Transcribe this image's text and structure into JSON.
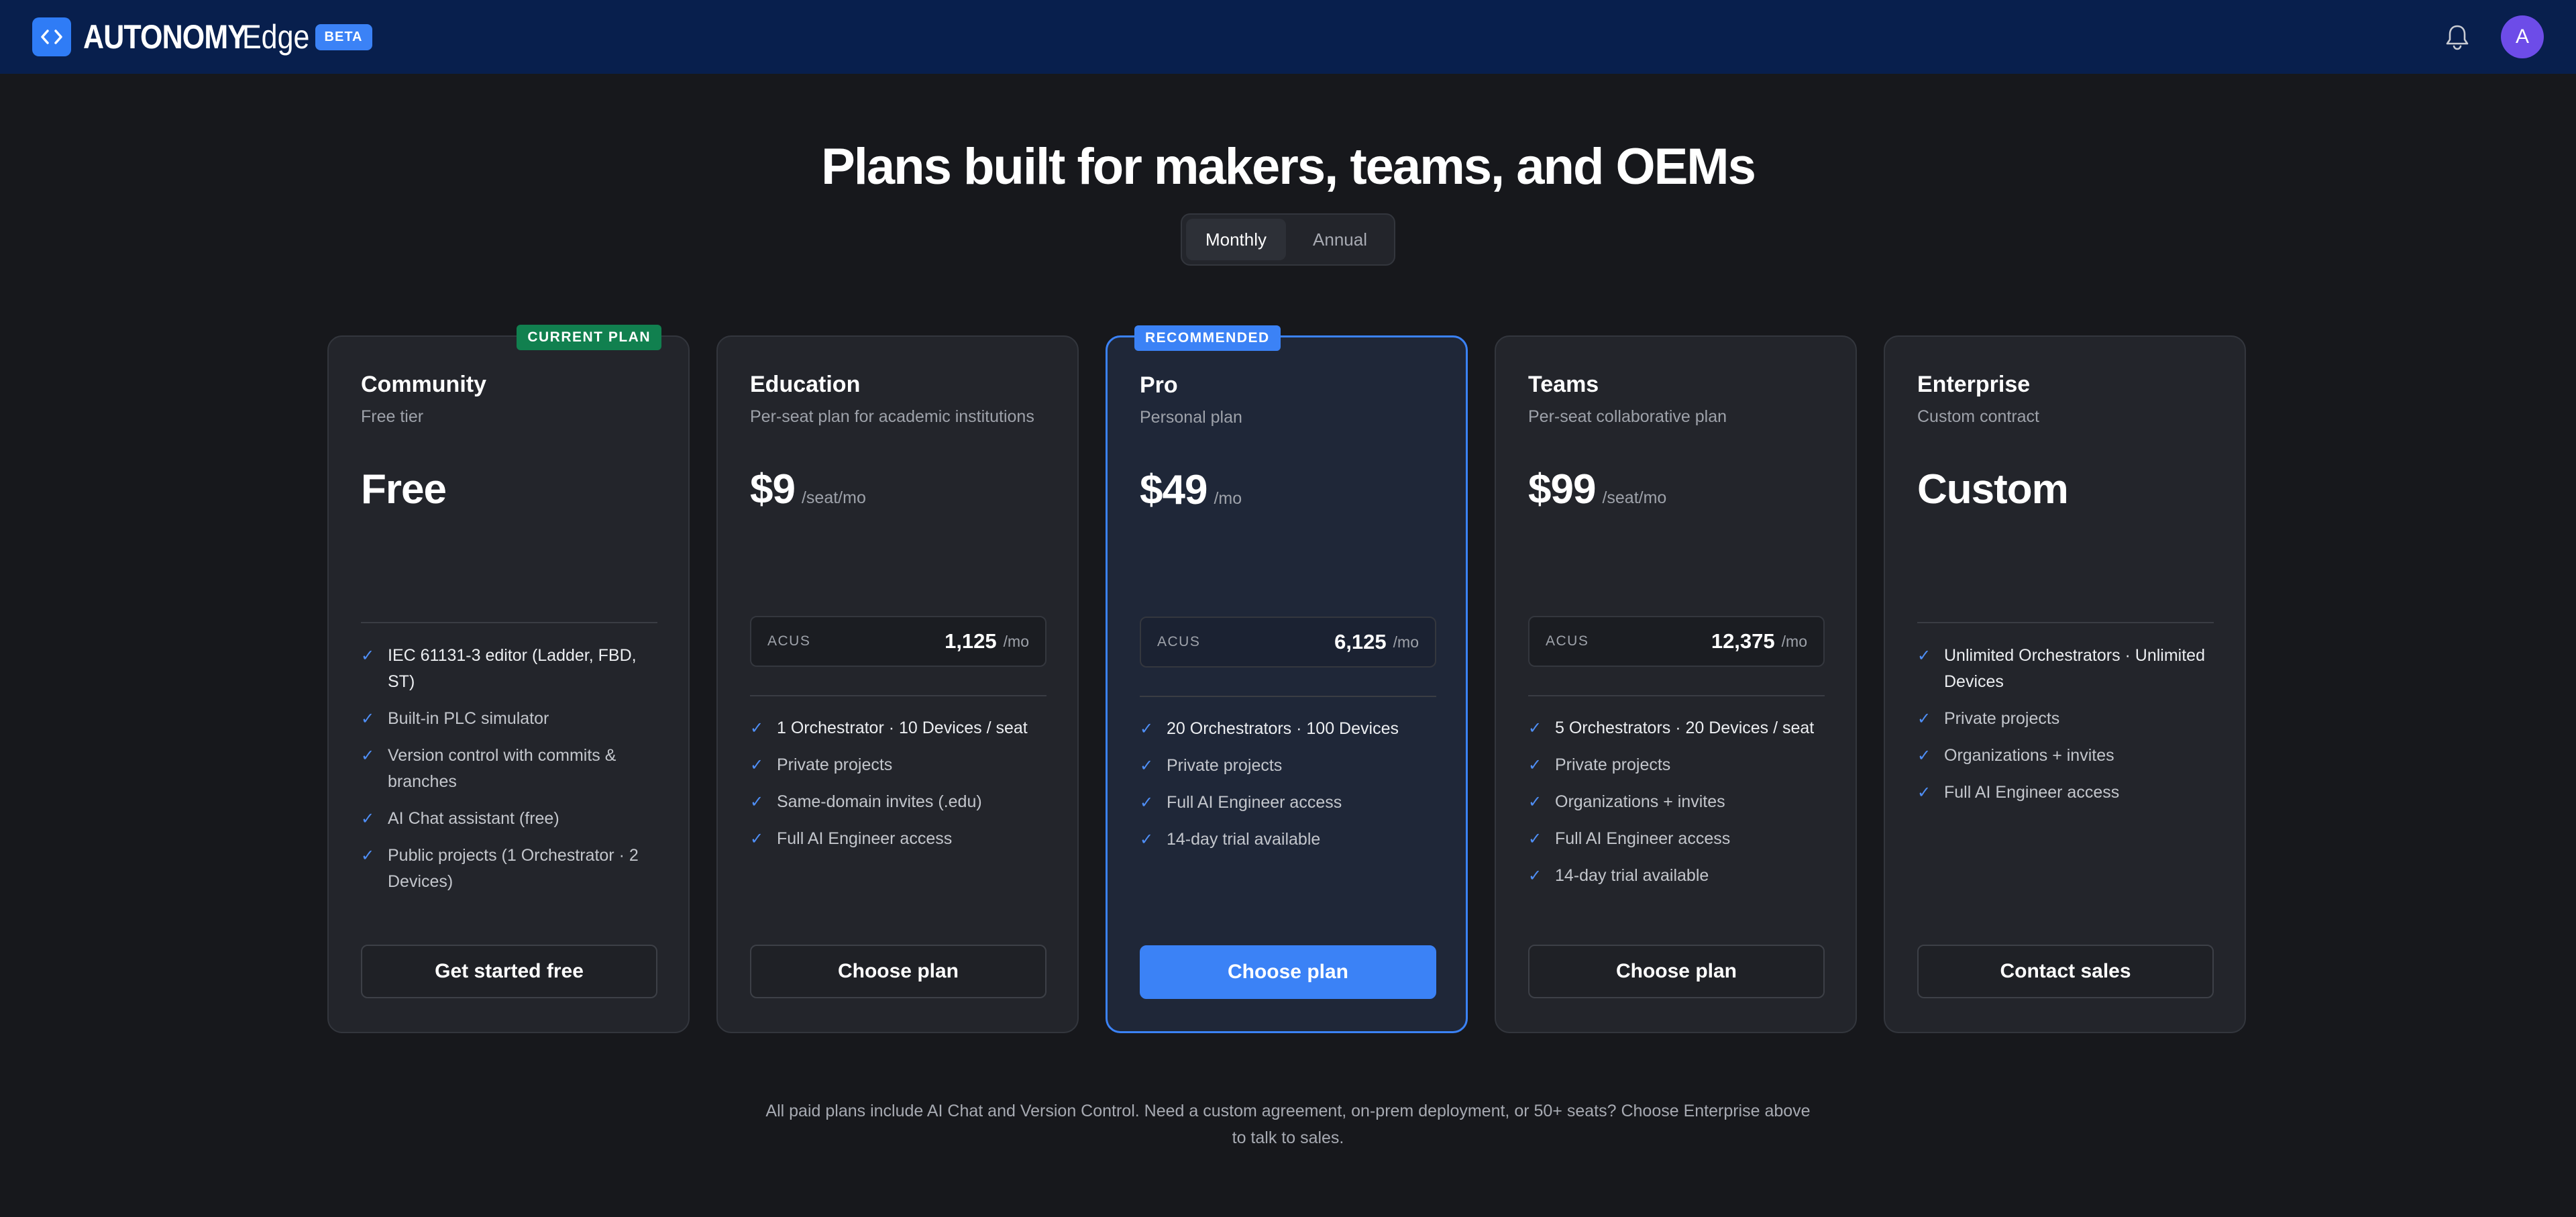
{
  "header": {
    "brand_bold": "AUTONOMY",
    "brand_light": "Edge",
    "beta_badge": "BETA",
    "avatar_initial": "A",
    "icons": [
      "code-icon",
      "bell-icon"
    ]
  },
  "page": {
    "title": "Plans built for makers, teams, and OEMs",
    "billing_toggle": {
      "monthly": "Monthly",
      "annual": "Annual",
      "selected": "Monthly"
    },
    "footnote": "All paid plans include AI Chat and Version Control. Need a custom agreement, on-prem deployment, or 50+ seats? Choose Enterprise above to talk to sales."
  },
  "colors": {
    "accent": "#3b82f6",
    "current_badge": "#11804f",
    "header_bg": "#081f4d",
    "page_bg": "#17181c"
  },
  "plans": [
    {
      "badge": "CURRENT PLAN",
      "name": "Community",
      "subtitle": "Free tier",
      "price": "Free",
      "unit": "",
      "features": [
        "IEC 61131-3 editor (Ladder, FBD, ST)",
        "Built-in PLC simulator",
        "Version control with commits & branches",
        "AI Chat assistant (free)",
        "Public projects (1 Orchestrator · 2 Devices)"
      ],
      "cta": "Get started free"
    },
    {
      "name": "Education",
      "subtitle": "Per-seat plan for academic institutions",
      "price": "$9",
      "unit": "/seat/mo",
      "acus_label": "ACUS",
      "acus_value": "1,125",
      "acus_unit": "/mo",
      "features": [
        "1 Orchestrator · 10 Devices / seat",
        "Private projects",
        "Same-domain invites (.edu)",
        "Full AI Engineer access"
      ],
      "cta": "Choose plan"
    },
    {
      "badge": "RECOMMENDED",
      "name": "Pro",
      "subtitle": "Personal plan",
      "price": "$49",
      "unit": "/mo",
      "acus_label": "ACUS",
      "acus_value": "6,125",
      "acus_unit": "/mo",
      "features": [
        "20 Orchestrators · 100 Devices",
        "Private projects",
        "Full AI Engineer access",
        "14-day trial available"
      ],
      "cta": "Choose plan"
    },
    {
      "name": "Teams",
      "subtitle": "Per-seat collaborative plan",
      "price": "$99",
      "unit": "/seat/mo",
      "acus_label": "ACUS",
      "acus_value": "12,375",
      "acus_unit": "/mo",
      "features": [
        "5 Orchestrators · 20 Devices / seat",
        "Private projects",
        "Organizations + invites",
        "Full AI Engineer access",
        "14-day trial available"
      ],
      "cta": "Choose plan"
    },
    {
      "name": "Enterprise",
      "subtitle": "Custom contract",
      "price": "Custom",
      "unit": "",
      "features": [
        "Unlimited Orchestrators · Unlimited Devices",
        "Private projects",
        "Organizations + invites",
        "Full AI Engineer access"
      ],
      "cta": "Contact sales"
    }
  ]
}
